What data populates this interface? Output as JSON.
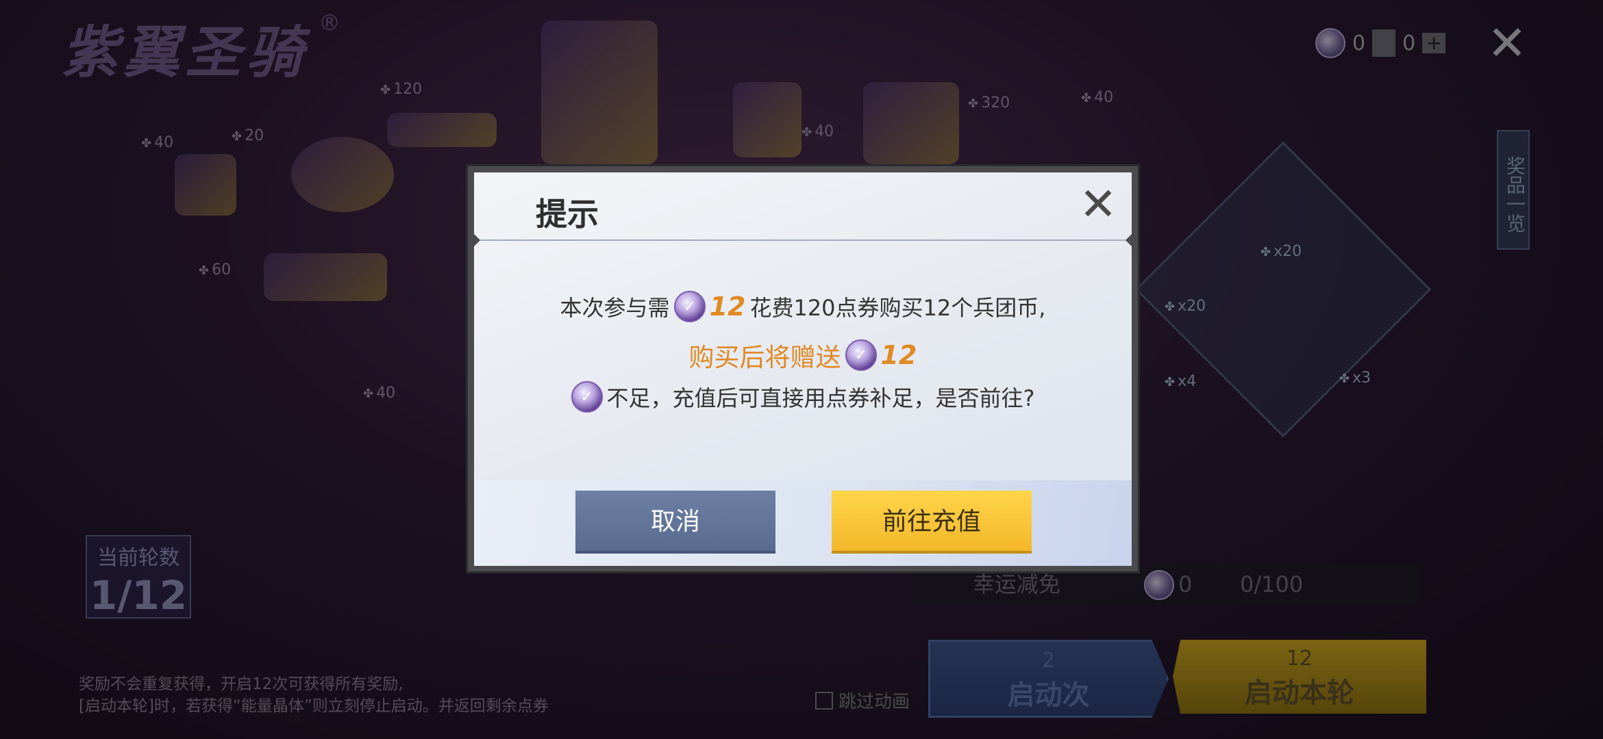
{
  "background": {
    "event_title": "紫翼圣骑",
    "registered_mark": "®",
    "prize_tags": [
      "120",
      "20",
      "40",
      "60",
      "40",
      "320",
      "40",
      "40"
    ],
    "resources": {
      "coin_count": "0",
      "card_count": "0"
    },
    "side_tab_label": "奖品一览",
    "reward_counts": [
      "x20",
      "x20",
      "x4",
      "x3"
    ],
    "current_round_label": "当前轮数",
    "current_round_value": "1/12",
    "luck_label": "幸运减免",
    "luck_coin_value": "0",
    "luck_progress": "0/100",
    "start_once_cost": "2",
    "start_once_label": "启动次",
    "start_round_cost": "12",
    "start_round_label": "启动本轮",
    "skip_animation_label": "跳过动画",
    "footer_line1": "奖励不会重复获得，开启12次可获得所有奖励,",
    "footer_line2": "[启动本轮]时，若获得“能量晶体”则立刻停止启动。并返回剩余点券"
  },
  "dialog": {
    "title": "提示",
    "line1_prefix": "本次参与需",
    "line1_coin_amount": "12",
    "line1_suffix": "花费120点券购买12个兵团币,",
    "line2_prefix": "购买后将赠送",
    "line2_coin_amount": "12",
    "line3_text": "不足，充值后可直接用点券补足，是否前往?",
    "cancel_label": "取消",
    "confirm_label": "前往充值"
  },
  "colors": {
    "accent_orange": "#e08a24",
    "confirm_yellow": "#f3b72a",
    "cancel_blue": "#5a6b90"
  }
}
